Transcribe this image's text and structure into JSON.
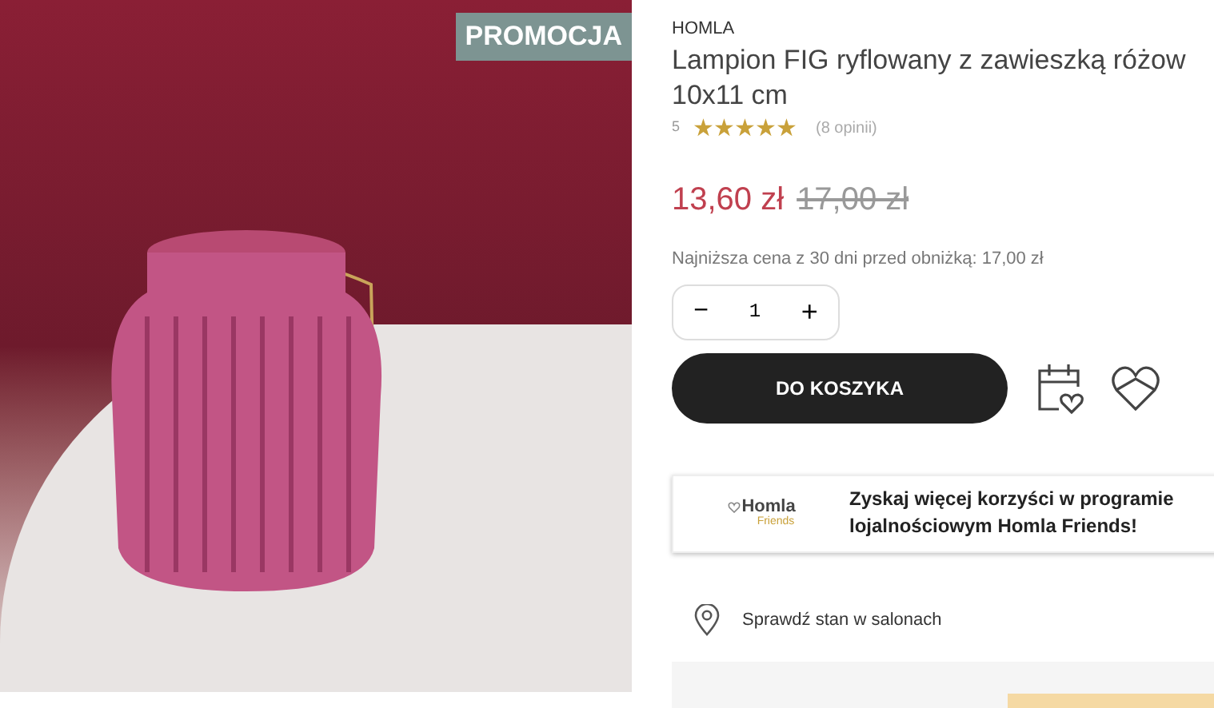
{
  "badge": "PROMOCJA",
  "product": {
    "brand": "HOMLA",
    "title_lines": [
      "Lampion FIG ryflowany z zawieszką różow",
      "10x11 cm"
    ],
    "rating": "5",
    "stars": 5,
    "reviews": "(8 opinii)"
  },
  "price": {
    "current": "13,60 zł",
    "old": "17,00 zł",
    "lowest_note": "Najniższa cena z 30 dni przed obniżką: 17,00 zł"
  },
  "quantity": {
    "minus": "−",
    "value": "1",
    "plus": "+"
  },
  "cart_button": "DO KOSZYKA",
  "loyalty": {
    "logo_name": "Homla",
    "logo_sub": "Friends",
    "text_lines": [
      "Zyskaj więcej korzyści w programie",
      "lojalnościowym Homla Friends!"
    ]
  },
  "store_check": "Sprawdź stan w salonach"
}
